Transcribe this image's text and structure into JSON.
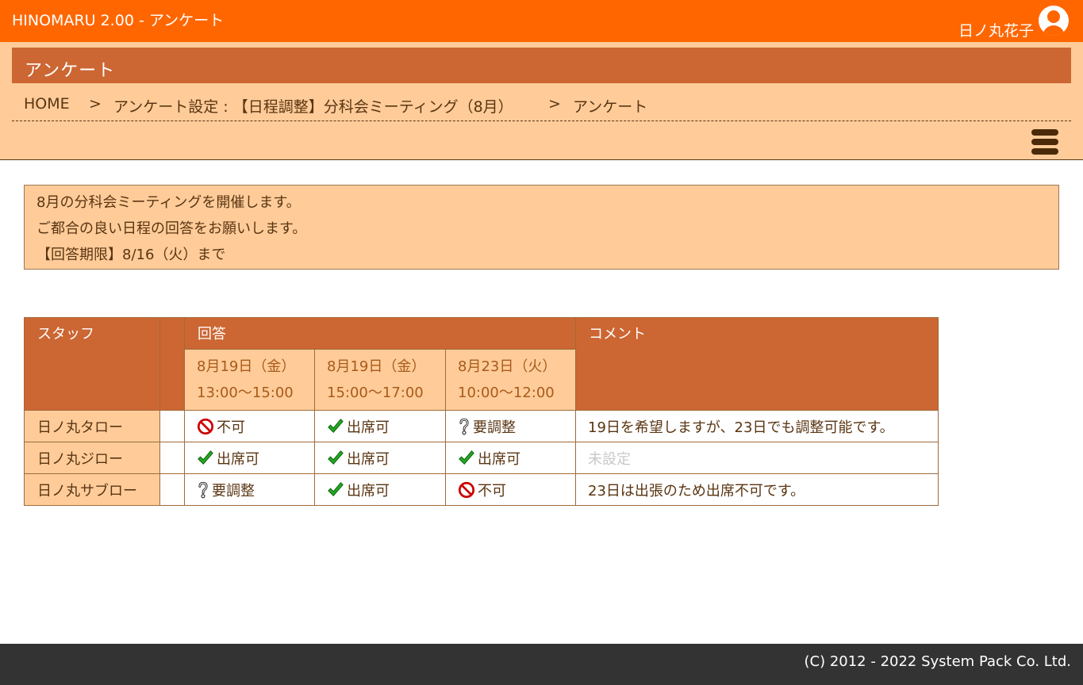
{
  "app": {
    "title": "HINOMARU 2.00 - アンケート",
    "user_name": "日ノ丸花子"
  },
  "page": {
    "heading": "アンケート"
  },
  "breadcrumb": {
    "home": "HOME",
    "sep1": ">",
    "level2": "アンケート設定 : 【日程調整】分科会ミーティング（8月）",
    "sep2": ">",
    "current": "アンケート"
  },
  "notice": {
    "line1": "8月の分科会ミーティングを開催します。",
    "line2": "ご都合の良い日程の回答をお願いします。",
    "line3": "【回答期限】8/16（火）まで"
  },
  "table": {
    "headers": {
      "staff": "スタッフ",
      "answers": "回答",
      "comment": "コメント"
    },
    "dates": [
      {
        "day": "8月19日（金）",
        "time": "13:00〜15:00"
      },
      {
        "day": "8月19日（金）",
        "time": "15:00〜17:00"
      },
      {
        "day": "8月23日（火）",
        "time": "10:00〜12:00"
      }
    ],
    "rows": [
      {
        "staff": "日ノ丸タロー",
        "answers": [
          "不可",
          "出席可",
          "要調整"
        ],
        "comment": "19日を希望しますが、23日でも調整可能です。"
      },
      {
        "staff": "日ノ丸ジロー",
        "answers": [
          "出席可",
          "出席可",
          "出席可"
        ],
        "comment": "未設定"
      },
      {
        "staff": "日ノ丸サブロー",
        "answers": [
          "要調整",
          "出席可",
          "不可"
        ],
        "comment": "23日は出張のため出席不可です。"
      }
    ]
  },
  "icons": {
    "user": "user-avatar-icon",
    "menu": "hamburger-menu-icon",
    "yes": "checkmark-icon",
    "no": "prohibited-icon",
    "maybe": "question-mark-icon"
  },
  "colors": {
    "topbar": "#ff6600",
    "heading": "#cc6633",
    "panel": "#ffcc99",
    "footer": "#333333",
    "check": "#22aa22",
    "no": "#cc0000"
  },
  "footer": {
    "copyright": "(C) 2012 - 2022 System Pack Co. Ltd."
  }
}
